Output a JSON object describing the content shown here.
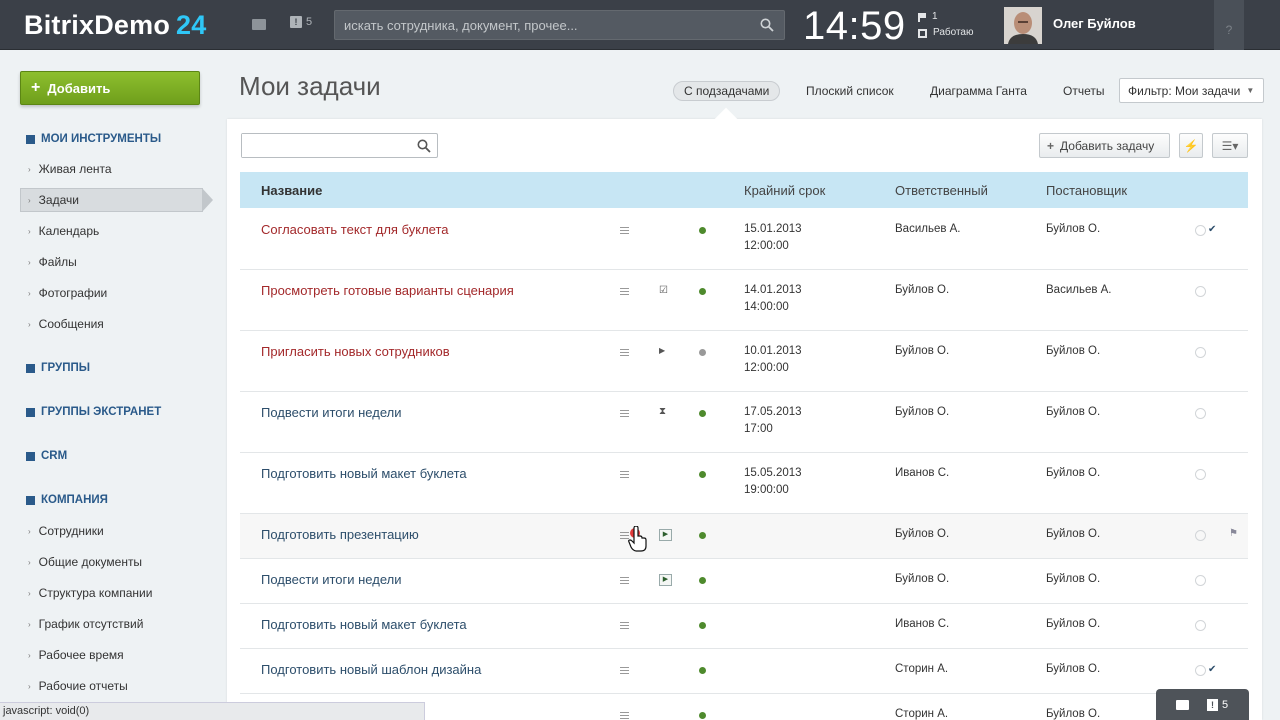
{
  "header": {
    "logo": "BitrixDemo",
    "logo_number": "24",
    "notifications_count": "5",
    "search_placeholder": "искать сотрудника, документ, прочее...",
    "clock": "14:59",
    "work_count": "1",
    "work_status": "Работаю",
    "user_name": "Олег Буйлов",
    "help": "?"
  },
  "sidebar": {
    "add_button": "Добавить",
    "sections": [
      {
        "label": "МОИ ИНСТРУМЕНТЫ"
      },
      {
        "label": "ГРУППЫ"
      },
      {
        "label": "ГРУППЫ ЭКСТРАНЕТ"
      },
      {
        "label": "CRM"
      },
      {
        "label": "КОМПАНИЯ"
      }
    ],
    "tools": [
      "Живая лента",
      "Задачи",
      "Календарь",
      "Файлы",
      "Фотографии",
      "Сообщения"
    ],
    "company": [
      "Сотрудники",
      "Общие документы",
      "Структура компании",
      "График отсутствий",
      "Рабочее время",
      "Рабочие отчеты"
    ]
  },
  "main": {
    "title": "Мои задачи",
    "tabs": [
      "С подзадачами",
      "Плоский список",
      "Диаграмма Ганта",
      "Отчеты"
    ],
    "filter": "Фильтр: Мои задачи",
    "add_task": "Добавить задачу",
    "columns": {
      "name": "Название",
      "deadline": "Крайний срок",
      "responsible": "Ответственный",
      "creator": "Постановщик"
    }
  },
  "tasks": [
    {
      "title": "Согласовать текст для буклета",
      "date": "15.01.2013",
      "time": "12:00:00",
      "responsible": "Васильев А.",
      "creator": "Буйлов О."
    },
    {
      "title": "Просмотреть готовые варианты сценария",
      "date": "14.01.2013",
      "time": "14:00:00",
      "responsible": "Буйлов О.",
      "creator": "Васильев А."
    },
    {
      "title": "Пригласить новых сотрудников",
      "date": "10.01.2013",
      "time": "12:00:00",
      "responsible": "Буйлов О.",
      "creator": "Буйлов О."
    },
    {
      "title": "Подвести итоги недели",
      "date": "17.05.2013",
      "time": "17:00",
      "responsible": "Буйлов О.",
      "creator": "Буйлов О."
    },
    {
      "title": "Подготовить новый макет буклета",
      "date": "15.05.2013",
      "time": "19:00:00",
      "responsible": "Иванов С.",
      "creator": "Буйлов О."
    },
    {
      "title": "Подготовить презентацию",
      "date": "",
      "time": "",
      "responsible": "Буйлов О.",
      "creator": "Буйлов О."
    },
    {
      "title": "Подвести итоги недели",
      "date": "",
      "time": "",
      "responsible": "Буйлов О.",
      "creator": "Буйлов О."
    },
    {
      "title": "Подготовить новый макет буклета",
      "date": "",
      "time": "",
      "responsible": "Иванов С.",
      "creator": "Буйлов О."
    },
    {
      "title": "Подготовить новый шаблон дизайна",
      "date": "",
      "time": "",
      "responsible": "Сторин А.",
      "creator": "Буйлов О."
    },
    {
      "title": "",
      "date": "",
      "time": "",
      "responsible": "Сторин А.",
      "creator": "Буйлов О."
    }
  ],
  "status_bar": "javascript: void(0)",
  "dock": {
    "notifications_count": "5"
  },
  "colors": {
    "accent_blue": "#2fc7f7",
    "overdue_red": "#a3292b",
    "header_bg": "#3b4048",
    "table_head": "#c7e6f4",
    "add_green": "#7bae24"
  }
}
